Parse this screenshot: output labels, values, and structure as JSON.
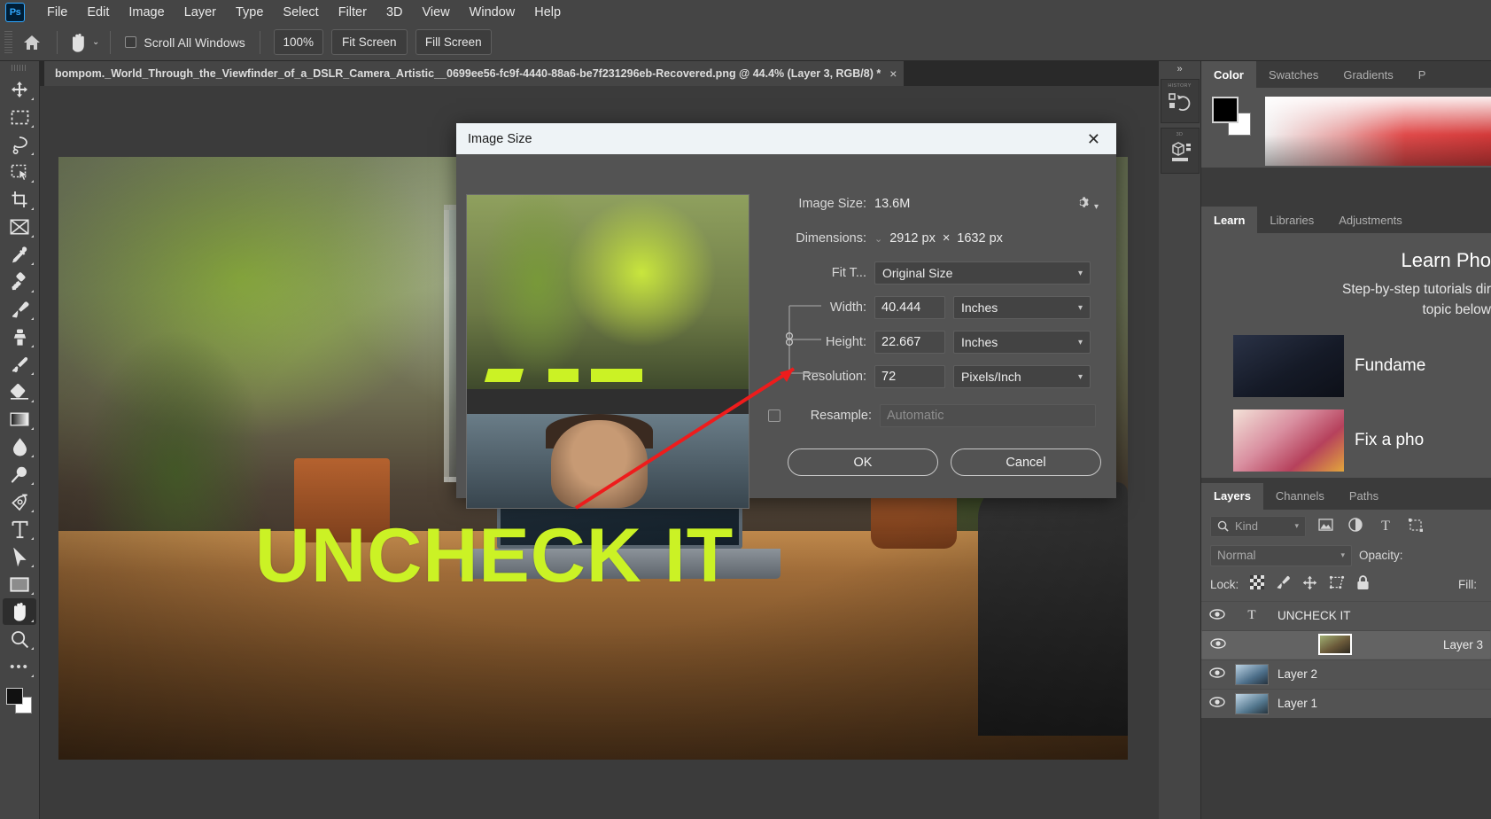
{
  "menubar": {
    "logo": "Ps",
    "items": [
      "File",
      "Edit",
      "Image",
      "Layer",
      "Type",
      "Select",
      "Filter",
      "3D",
      "View",
      "Window",
      "Help"
    ]
  },
  "options_bar": {
    "home_icon": "home-icon",
    "tool_icon": "hand-tool-icon",
    "chevron": "⌄",
    "scroll_all_windows_label": "Scroll All Windows",
    "scroll_all_windows_checked": false,
    "zoom_100_label": "100%",
    "fit_screen_label": "Fit Screen",
    "fill_screen_label": "Fill Screen"
  },
  "toolbar": {
    "tools": [
      {
        "name": "move-tool",
        "active": false
      },
      {
        "name": "rectangular-marquee-tool",
        "active": false
      },
      {
        "name": "lasso-tool",
        "active": false
      },
      {
        "name": "object-selection-tool",
        "active": false
      },
      {
        "name": "crop-tool",
        "active": false
      },
      {
        "name": "frame-tool",
        "active": false
      },
      {
        "name": "eyedropper-tool",
        "active": false
      },
      {
        "name": "spot-healing-brush-tool",
        "active": false
      },
      {
        "name": "brush-tool",
        "active": false
      },
      {
        "name": "clone-stamp-tool",
        "active": false
      },
      {
        "name": "history-brush-tool",
        "active": false
      },
      {
        "name": "eraser-tool",
        "active": false
      },
      {
        "name": "gradient-tool",
        "active": false
      },
      {
        "name": "blur-tool",
        "active": false
      },
      {
        "name": "dodge-tool",
        "active": false
      },
      {
        "name": "pen-tool",
        "active": false
      },
      {
        "name": "horizontal-type-tool",
        "active": false
      },
      {
        "name": "path-selection-tool",
        "active": false
      },
      {
        "name": "rectangle-tool",
        "active": false
      },
      {
        "name": "hand-tool",
        "active": true
      },
      {
        "name": "zoom-tool",
        "active": false
      }
    ],
    "more_tools_glyph": "•••",
    "foreground_color": "#111111",
    "background_color": "#ffffff"
  },
  "document": {
    "tab_title": "bompom._World_Through_the_Viewfinder_of_a_DSLR_Camera_Artistic__0699ee56-fc9f-4440-88a6-be7f231296eb-Recovered.png @ 44.4% (Layer 3, RGB/8) *",
    "tab_close_glyph": "×",
    "canvas_overlay_text": "UNCHECK IT",
    "overlay_text_color": "#cbf225"
  },
  "dialog": {
    "title": "Image Size",
    "close_glyph": "✕",
    "gear_icon": "gear-icon",
    "image_size_label": "Image Size:",
    "image_size_value": "13.6M",
    "dimensions_label": "Dimensions:",
    "dimensions_chevron": "⌄",
    "dimensions_width": "2912 px",
    "dimensions_separator": "×",
    "dimensions_height": "1632 px",
    "fit_to_label": "Fit T...",
    "fit_to_value": "Original Size",
    "width_label": "Width:",
    "width_value": "40.444",
    "width_unit": "Inches",
    "height_label": "Height:",
    "height_value": "22.667",
    "height_unit": "Inches",
    "resolution_label": "Resolution:",
    "resolution_value": "72",
    "resolution_unit": "Pixels/Inch",
    "resample_label": "Resample:",
    "resample_checked": false,
    "resample_value": "Automatic",
    "ok_label": "OK",
    "cancel_label": "Cancel",
    "annotation_arrow_color": "#ee1c1c"
  },
  "right_dock": {
    "collapse_glyph": "»",
    "mini_panels": [
      {
        "title": "HISTORY",
        "icon": "history-icon"
      },
      {
        "title": "3D",
        "icon": "cube-icon"
      }
    ],
    "color_group": {
      "tabs": [
        {
          "label": "Color",
          "active": true
        },
        {
          "label": "Swatches",
          "active": false
        },
        {
          "label": "Gradients",
          "active": false
        },
        {
          "label": "P",
          "active": false
        }
      ],
      "foreground": "#000000",
      "background": "#ffffff"
    },
    "learn_group": {
      "tabs": [
        {
          "label": "Learn",
          "active": true
        },
        {
          "label": "Libraries",
          "active": false
        },
        {
          "label": "Adjustments",
          "active": false
        }
      ],
      "title": "Learn Pho",
      "subtitle_line1": "Step-by-step tutorials dir",
      "subtitle_line2": "topic below",
      "cards": [
        {
          "label": "Fundame",
          "thumb": "dark-room-thumbnail"
        },
        {
          "label": "Fix a pho",
          "thumb": "flowers-thumbnail"
        }
      ]
    },
    "layers_group": {
      "tabs": [
        {
          "label": "Layers",
          "active": true
        },
        {
          "label": "Channels",
          "active": false
        },
        {
          "label": "Paths",
          "active": false
        }
      ],
      "filter_placeholder": "Kind",
      "filter_icons": [
        "image-filter-icon",
        "adjustment-filter-icon",
        "type-filter-icon",
        "shape-filter-icon"
      ],
      "blend_mode": "Normal",
      "opacity_label": "Opacity:",
      "lock_label": "Lock:",
      "lock_icons": [
        "lock-transparency-icon",
        "lock-image-icon",
        "lock-position-icon",
        "lock-artboard-icon",
        "lock-all-icon"
      ],
      "fill_label": "Fill:",
      "layers": [
        {
          "name": "UNCHECK IT",
          "type": "text",
          "visible": true,
          "selected": false
        },
        {
          "name": "Layer 3",
          "type": "image",
          "visible": true,
          "selected": true
        },
        {
          "name": "Layer 2",
          "type": "image",
          "visible": true,
          "selected": false
        },
        {
          "name": "Layer 1",
          "type": "image",
          "visible": true,
          "selected": false
        }
      ],
      "eye_glyph": "◉",
      "type_glyph": "T"
    }
  }
}
